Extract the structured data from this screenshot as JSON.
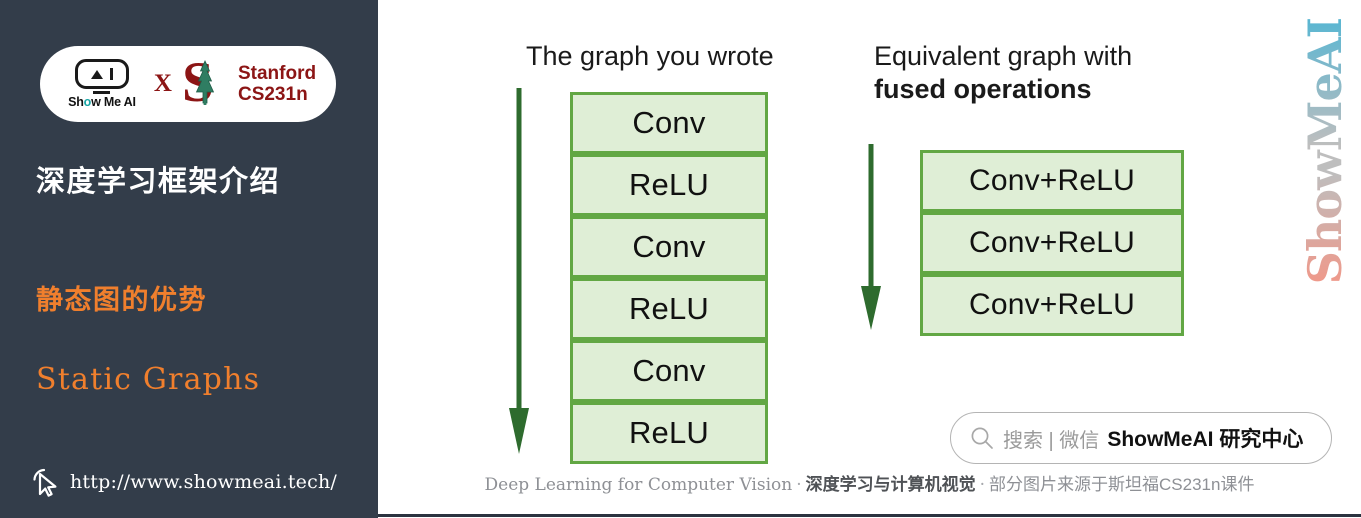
{
  "sidebar": {
    "logo": {
      "showmeai_label": "Show Me AI",
      "showmeai_pre": "Sh",
      "showmeai_o": "o",
      "showmeai_post": "w Me AI",
      "cross": "X",
      "stanford_letter": "S",
      "stanford_line1": "Stanford",
      "stanford_line2": "CS231n"
    },
    "title": "深度学习框架介绍",
    "subtitle_cn": "静态图的优势",
    "subtitle_en": "Static Graphs",
    "url": "http://www.showmeai.tech/",
    "cursor_icon": "cursor-arrow-icon",
    "bg_color": "#333d4a",
    "accent_color": "#f07f2d"
  },
  "main": {
    "left_column": {
      "heading": "The graph you wrote",
      "boxes": [
        "Conv",
        "ReLU",
        "Conv",
        "ReLU",
        "Conv",
        "ReLU"
      ],
      "arrow_icon": "down-arrow-icon"
    },
    "right_column": {
      "heading_line1": "Equivalent graph with",
      "heading_line2": "fused operations",
      "boxes": [
        "Conv+ReLU",
        "Conv+ReLU",
        "Conv+ReLU"
      ],
      "arrow_icon": "down-arrow-icon"
    },
    "box_fill_color": "#dfeed6",
    "box_border_color": "#62a744",
    "arrow_color": "#2e6b2e"
  },
  "watermark": {
    "text": "ShowMeAI"
  },
  "search": {
    "icon": "search-icon",
    "placeholder": "搜索 | 微信",
    "brand": "ShowMeAI 研究中心"
  },
  "footer": {
    "en": "Deep Learning for Computer Vision",
    "sep1": "·",
    "cn_bold": "深度学习与计算机视觉",
    "sep2": "·",
    "cn_note": "部分图片来源于斯坦福CS231n课件"
  }
}
